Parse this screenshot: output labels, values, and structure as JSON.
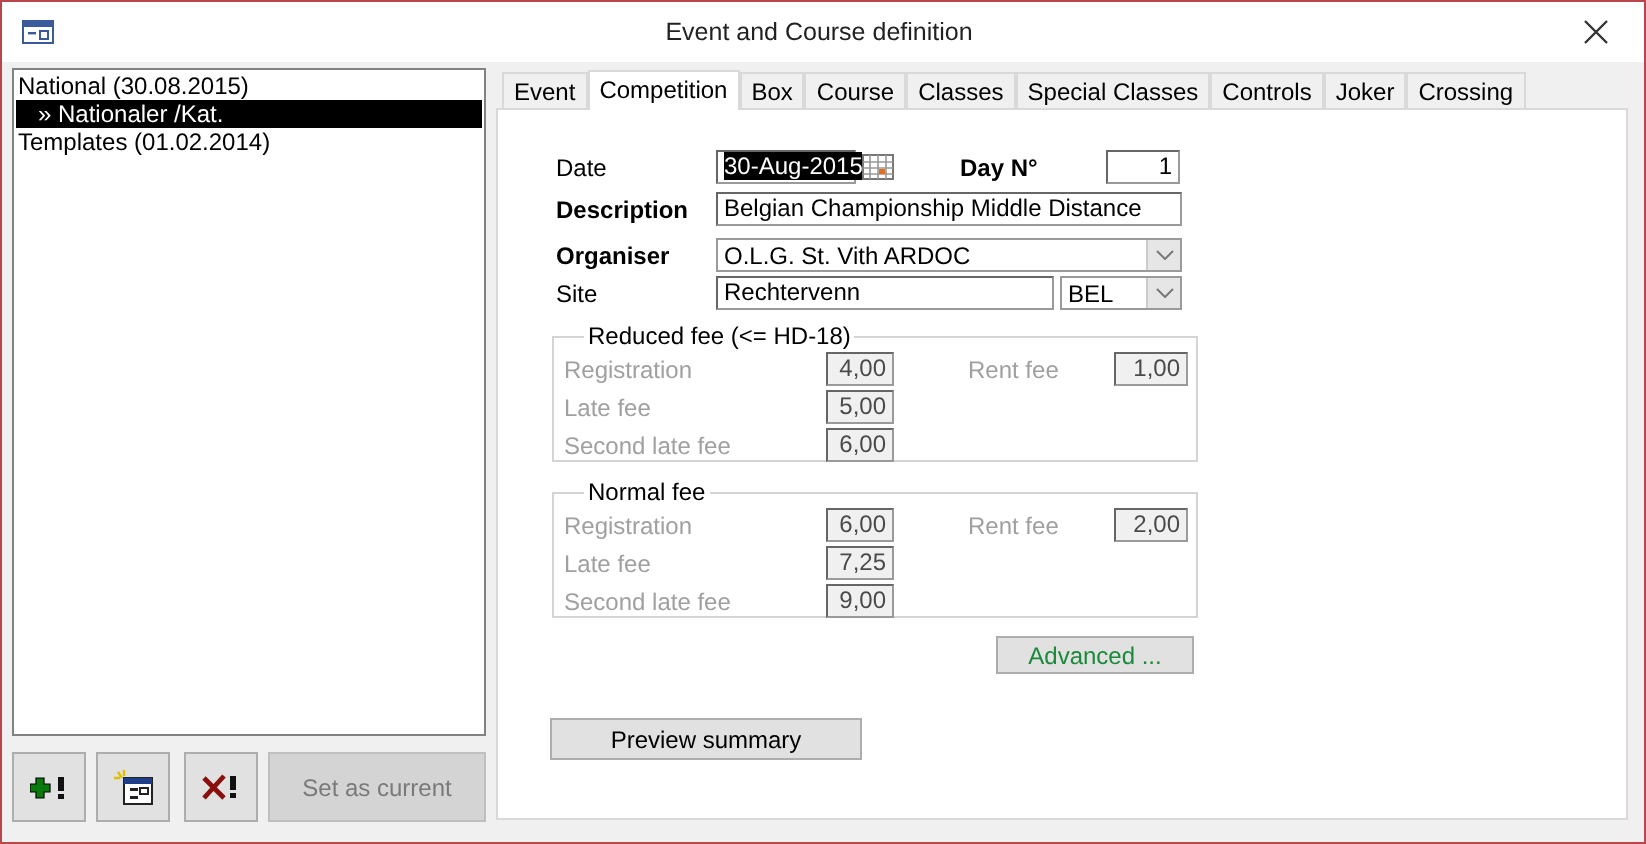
{
  "window": {
    "title": "Event and Course definition"
  },
  "tree": [
    {
      "label": "National (30.08.2015)",
      "selected": false,
      "expanded": true,
      "children": [
        {
          "label": "» Nationaler /Kat.",
          "selected": true
        }
      ]
    },
    {
      "label": "Templates (01.02.2014)",
      "selected": false
    }
  ],
  "list_buttons": [
    {
      "kind": "add",
      "disabled": false
    },
    {
      "kind": "new",
      "disabled": false
    },
    {
      "kind": "delete",
      "disabled": false
    },
    {
      "kind": "text",
      "label": "Set as current",
      "disabled": true
    }
  ],
  "tabs": [
    {
      "label": "Event",
      "selected": false
    },
    {
      "label": "Competition",
      "selected": true
    },
    {
      "label": "Box",
      "selected": false
    },
    {
      "label": "Course",
      "selected": false
    },
    {
      "label": "Classes",
      "selected": false
    },
    {
      "label": "Special Classes",
      "selected": false
    },
    {
      "label": "Controls",
      "selected": false
    },
    {
      "label": "Joker",
      "selected": false
    },
    {
      "label": "Crossing",
      "selected": false
    }
  ],
  "competition": {
    "date": {
      "label": "Date",
      "value": "30-Aug-2015",
      "highlighted": true
    },
    "day": {
      "label": "Day N°",
      "value": "1"
    },
    "description": {
      "label": "Description",
      "value": "Belgian Championship Middle Distance"
    },
    "organiser": {
      "label": "Organiser",
      "value": "O.L.G. St. Vith ARDOC"
    },
    "site": {
      "label": "Site",
      "value": "Rechtervenn",
      "country": "BEL"
    },
    "fee_groups": [
      {
        "title": "Reduced fee (<= HD-18)",
        "disabled": true,
        "registration": {
          "label": "Registration",
          "value": "4,00"
        },
        "late": {
          "label": "Late fee",
          "value": "5,00"
        },
        "second_late": {
          "label": "Second late fee",
          "value": "6,00"
        },
        "rent": {
          "label": "Rent fee",
          "value": "1,00"
        }
      },
      {
        "title": "Normal fee",
        "disabled": true,
        "registration": {
          "label": "Registration",
          "value": "6,00"
        },
        "late": {
          "label": "Late fee",
          "value": "7,25"
        },
        "second_late": {
          "label": "Second late fee",
          "value": "9,00"
        },
        "rent": {
          "label": "Rent fee",
          "value": "2,00"
        }
      }
    ],
    "advanced_button": "Advanced ...",
    "preview_button": "Preview summary"
  }
}
